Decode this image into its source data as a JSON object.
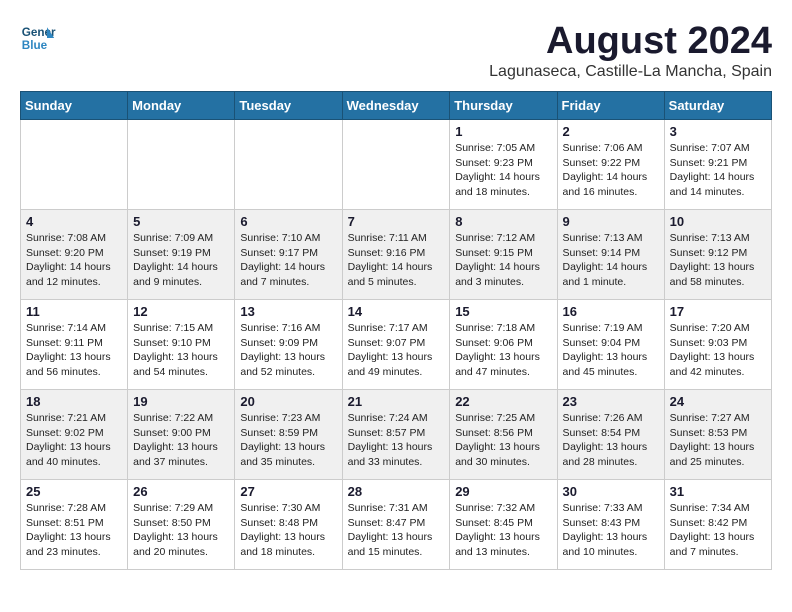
{
  "header": {
    "logo_line1": "General",
    "logo_line2": "Blue",
    "month_title": "August 2024",
    "location": "Lagunaseca, Castille-La Mancha, Spain"
  },
  "weekdays": [
    "Sunday",
    "Monday",
    "Tuesday",
    "Wednesday",
    "Thursday",
    "Friday",
    "Saturday"
  ],
  "weeks": [
    [
      {
        "day": "",
        "info": ""
      },
      {
        "day": "",
        "info": ""
      },
      {
        "day": "",
        "info": ""
      },
      {
        "day": "",
        "info": ""
      },
      {
        "day": "1",
        "info": "Sunrise: 7:05 AM\nSunset: 9:23 PM\nDaylight: 14 hours\nand 18 minutes."
      },
      {
        "day": "2",
        "info": "Sunrise: 7:06 AM\nSunset: 9:22 PM\nDaylight: 14 hours\nand 16 minutes."
      },
      {
        "day": "3",
        "info": "Sunrise: 7:07 AM\nSunset: 9:21 PM\nDaylight: 14 hours\nand 14 minutes."
      }
    ],
    [
      {
        "day": "4",
        "info": "Sunrise: 7:08 AM\nSunset: 9:20 PM\nDaylight: 14 hours\nand 12 minutes."
      },
      {
        "day": "5",
        "info": "Sunrise: 7:09 AM\nSunset: 9:19 PM\nDaylight: 14 hours\nand 9 minutes."
      },
      {
        "day": "6",
        "info": "Sunrise: 7:10 AM\nSunset: 9:17 PM\nDaylight: 14 hours\nand 7 minutes."
      },
      {
        "day": "7",
        "info": "Sunrise: 7:11 AM\nSunset: 9:16 PM\nDaylight: 14 hours\nand 5 minutes."
      },
      {
        "day": "8",
        "info": "Sunrise: 7:12 AM\nSunset: 9:15 PM\nDaylight: 14 hours\nand 3 minutes."
      },
      {
        "day": "9",
        "info": "Sunrise: 7:13 AM\nSunset: 9:14 PM\nDaylight: 14 hours\nand 1 minute."
      },
      {
        "day": "10",
        "info": "Sunrise: 7:13 AM\nSunset: 9:12 PM\nDaylight: 13 hours\nand 58 minutes."
      }
    ],
    [
      {
        "day": "11",
        "info": "Sunrise: 7:14 AM\nSunset: 9:11 PM\nDaylight: 13 hours\nand 56 minutes."
      },
      {
        "day": "12",
        "info": "Sunrise: 7:15 AM\nSunset: 9:10 PM\nDaylight: 13 hours\nand 54 minutes."
      },
      {
        "day": "13",
        "info": "Sunrise: 7:16 AM\nSunset: 9:09 PM\nDaylight: 13 hours\nand 52 minutes."
      },
      {
        "day": "14",
        "info": "Sunrise: 7:17 AM\nSunset: 9:07 PM\nDaylight: 13 hours\nand 49 minutes."
      },
      {
        "day": "15",
        "info": "Sunrise: 7:18 AM\nSunset: 9:06 PM\nDaylight: 13 hours\nand 47 minutes."
      },
      {
        "day": "16",
        "info": "Sunrise: 7:19 AM\nSunset: 9:04 PM\nDaylight: 13 hours\nand 45 minutes."
      },
      {
        "day": "17",
        "info": "Sunrise: 7:20 AM\nSunset: 9:03 PM\nDaylight: 13 hours\nand 42 minutes."
      }
    ],
    [
      {
        "day": "18",
        "info": "Sunrise: 7:21 AM\nSunset: 9:02 PM\nDaylight: 13 hours\nand 40 minutes."
      },
      {
        "day": "19",
        "info": "Sunrise: 7:22 AM\nSunset: 9:00 PM\nDaylight: 13 hours\nand 37 minutes."
      },
      {
        "day": "20",
        "info": "Sunrise: 7:23 AM\nSunset: 8:59 PM\nDaylight: 13 hours\nand 35 minutes."
      },
      {
        "day": "21",
        "info": "Sunrise: 7:24 AM\nSunset: 8:57 PM\nDaylight: 13 hours\nand 33 minutes."
      },
      {
        "day": "22",
        "info": "Sunrise: 7:25 AM\nSunset: 8:56 PM\nDaylight: 13 hours\nand 30 minutes."
      },
      {
        "day": "23",
        "info": "Sunrise: 7:26 AM\nSunset: 8:54 PM\nDaylight: 13 hours\nand 28 minutes."
      },
      {
        "day": "24",
        "info": "Sunrise: 7:27 AM\nSunset: 8:53 PM\nDaylight: 13 hours\nand 25 minutes."
      }
    ],
    [
      {
        "day": "25",
        "info": "Sunrise: 7:28 AM\nSunset: 8:51 PM\nDaylight: 13 hours\nand 23 minutes."
      },
      {
        "day": "26",
        "info": "Sunrise: 7:29 AM\nSunset: 8:50 PM\nDaylight: 13 hours\nand 20 minutes."
      },
      {
        "day": "27",
        "info": "Sunrise: 7:30 AM\nSunset: 8:48 PM\nDaylight: 13 hours\nand 18 minutes."
      },
      {
        "day": "28",
        "info": "Sunrise: 7:31 AM\nSunset: 8:47 PM\nDaylight: 13 hours\nand 15 minutes."
      },
      {
        "day": "29",
        "info": "Sunrise: 7:32 AM\nSunset: 8:45 PM\nDaylight: 13 hours\nand 13 minutes."
      },
      {
        "day": "30",
        "info": "Sunrise: 7:33 AM\nSunset: 8:43 PM\nDaylight: 13 hours\nand 10 minutes."
      },
      {
        "day": "31",
        "info": "Sunrise: 7:34 AM\nSunset: 8:42 PM\nDaylight: 13 hours\nand 7 minutes."
      }
    ]
  ]
}
